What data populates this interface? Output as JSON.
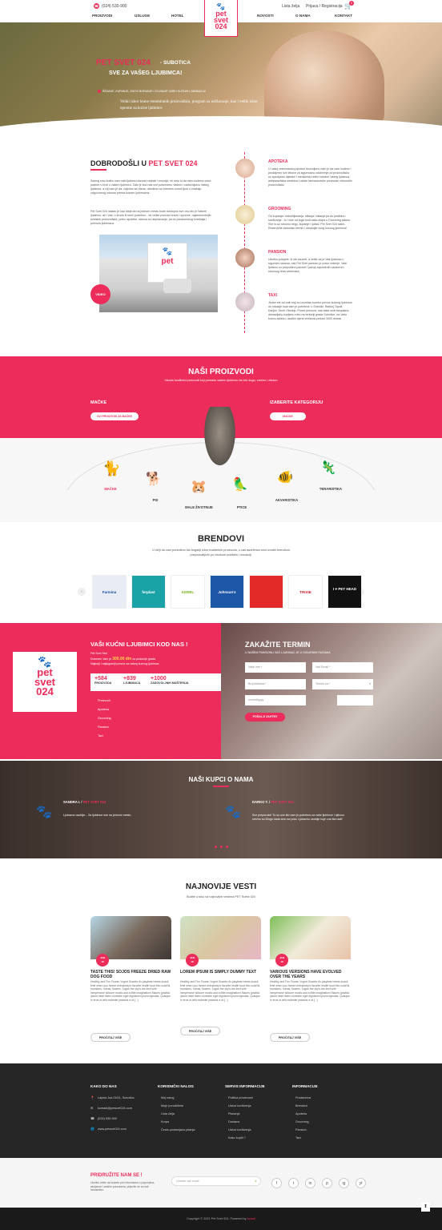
{
  "topbar": {
    "phone": "(024) 530-900",
    "wishlist": "Lista želja",
    "login": "Prijava / Registracija",
    "cart_count": "0"
  },
  "nav": {
    "left": [
      "PROIZVODI",
      "USLUGE",
      "HOTEL"
    ],
    "right": [
      "NOVOSTI",
      "O NAMA",
      "KONTAKT"
    ]
  },
  "logo": {
    "line1": "pet",
    "line2": "svet",
    "line3": "024"
  },
  "hero": {
    "brand": "PET SVET 024",
    "city": "- SUBOTICA",
    "subtitle": "SVE ZA VAŠEG LJUBIMCA!",
    "tagline": "ŠIŠANJE, KUPANJE, ZNOVI BORANJE I ČUVANJE VAŠIH KUĆNIH LJUBIMACA!",
    "text": "Veliki izbor hrane renomiranih proizvođača, program za održavanje, kao i veliki izbor opreme za kućne ljubimce"
  },
  "welcome": {
    "title": "DOBRODOŠLI U",
    "brand": "PET SVET 024",
    "p1": "Saznaj smo koliko nam naši ljubimci donose radosti i emocija, mi smo tu da vam budemo pravi partner u brizi o vašem ljubimcu. Zato je kod nas sve posvećeno Vašem i zadovoljstvu Vašeg ljubimca, a cilj nam je da, zajedno sa Vama, ubedimo na vremenu svesti ljudi o značaju odgovornog odnosa prema kućnim ljubimcima.",
    "p2": "Pet Svet 024 nastao je kao ideja da na jednom mestu bude dostupno sve ono što je Vašem ljubimcu, ali i Vas, u životu ili sreći potrebno - od velike ponude hrane i opreme, najeminentnijih svetskih proizvođača, preko apoteke, salona za ulepšavanje, pa do pansionskog smeštaja i prevoza ljubimaca.",
    "video_label": "VIDEO"
  },
  "services": [
    {
      "title": "APOTEKA",
      "text": "U našoj veterinarskoj apoteci dozvoljeno nam je da vam nudimo i prodajemo sve lekove za sigurnosno odobrenje od proizvođača uz specijalan dijetalni i medicinski režim ishrane Vašeg ljubimca, antiparazitska sredstva i ostale farmaceutske proizvode vrhunskih proizvođača."
    },
    {
      "title": "GROOMING",
      "text": "Od kupanja i raščešljavanja, šišanja i šišanja pa do pedikira i sređivanja - to i više od toga nudi naša ekipa u Grooming salonu. Sve to uz stručnu negu, kupanje i ljubav. Pet Svet 024 salon. Rezervišite slobodan termin i ulepšajte svog kućnog ljubimca!"
    },
    {
      "title": "PANSION",
      "text": "Ukoliko putujete, ili ste zauzeti, a želite da je Vaš ljubimac u sigurnim rukama, naš Pet Svet pansion je pravo rešenje. Vaši ljubimci su prepušteni pomoći i pažnji zaposlenih nadzorom stručnog tima veterinara."
    },
    {
      "title": "TAXI",
      "text": "Jedan ste od onih koji su izuzetan komfor prevoz kućnog ljubimca do lokacije koja vam je potrebna: u Subotici, Bačkoj Topoli, Kanjiži, Senti i Bečeju. Pored prevoza, naš taksi nudi besplatnu dostavljaču kupljenu robu na teritoriji grada Subotice, na Vašu kućnu adresu, ukoliko njena vrednost prelazi 3000 dinara."
    }
  ],
  "products": {
    "title": "NAŠI PROIZVODI",
    "subtitle": "Visoka kvalitetni proizvodi koji pomažu vašem ljubimcu da živi dugo, srećno i zdravo",
    "left_label": "MAČKE",
    "left_btn": "SVI PROIZVODI ZA MAČKE",
    "right_label": "IZABERITE KATEGORIJU",
    "right_btn": "MAČKE",
    "animals": [
      "MAČKE",
      "PSI",
      "MALE ŽIVOTINJE",
      "PTICE",
      "AKVARISTIKA",
      "TERARISTIKA"
    ]
  },
  "brands": {
    "title": "BRENDOVI",
    "subtitle": "U želji da vam ponudimo što bogatiji izbor kvalitetnih proizvoda, u naš asortiman smo uvrstili brendova prepoznatljivih po visokom kvalitetu i inovaciji.",
    "items": [
      "Farmina",
      "ferplast",
      "KERBL",
      "Johnson's",
      "",
      "TRIXIE",
      "I ♥ PET HEAD"
    ]
  },
  "pets": {
    "title": "VAŠI KUĆNI LJUBIMCI KOD NAS !",
    "line1": "Pet Svet Taxi",
    "line2": "Dovezen Vam je",
    "amount": "300.00 din",
    "line2b": "za područje grada",
    "line3": "Najbolji i najsigurniji prevoz za vašeg kućnog ljubimca",
    "stats": [
      {
        "value": "+584",
        "label": "PROIZVODA"
      },
      {
        "value": "+839",
        "label": "LJUBIMACA"
      },
      {
        "value": "+1000",
        "label": "ZADOVOLJNIH MUŠTERIJA"
      }
    ],
    "list": [
      "Proizvodi",
      "Apoteka",
      "Grooming",
      "Pansion",
      "Taxi"
    ]
  },
  "appointment": {
    "title": "ZAKAŽITE TERMIN",
    "subtitle": "U NAŠEM PANSIONU VAŠ LJUBIMAC JE U SIGURNIM RUKAMA",
    "name_ph": "Vaše ime *",
    "email_ph": "Vaš Email *",
    "phone_ph": "Broj telefona *",
    "service": "Termin za *",
    "date_ph": "mm/dd/yyyy",
    "submit": "POŠALJI ZAHTEV"
  },
  "testimonials": {
    "title": "NAŠI KUPCI O NAMA",
    "items": [
      {
        "name": "SANDRA I.",
        "brand": "PET SVET 024",
        "text": "Ljubazno osoblje... Za ljubimce sve na jednom mestu"
      },
      {
        "name": "DARKO T.",
        "brand": "PET SVET 024",
        "text": "Sve preporuke! Tu su sve što vam je potrebno za vaše ljubimce i njihovo srećno sa Dingo kada smo sa puta. Ljubazno osoblje koje zna šta radi!"
      }
    ]
  },
  "news": {
    "title": "NAJNOVIJE VESTI",
    "subtitle": "Budite u toku sa najnovijim vestima PET Sveta 024",
    "items": [
      {
        "month": "JAN",
        "day": "18",
        "title": "TASTE THIS! SOJOS FREEZE DRIED RAW DOG FOOD",
        "text": "Healthy and Fun Frozen Yogurt Snacks it's playtime meets snack time when you freeze everybody's favorite health food into colorful monsters, robots, flowers. Logos the sky's the limit with inexpensive silicone molds and a little imagination! Mauris gravida ipsum vitae libero molestie eget dignissim ipsum egestas. Quisque in eros id velit molestie placerat a ut [...]",
        "btn": "PROČITAJ VIŠE"
      },
      {
        "month": "JAN",
        "day": "18",
        "title": "LOREM IPSUM IS SIMPLY DUMMY TEXT",
        "text": "Healthy and Fun Frozen Yogurt Snacks it's playtime meets snack time when you freeze everybody's favorite health food into colorful monsters, robots, flowers. Logos the sky's the limit with inexpensive silicone molds and a little imagination! Mauris gravida ipsum vitae libero molestie eget dignissim ipsum egestas. Quisque in eros id velit molestie placerat a ut [...]",
        "btn": "PROČITAJ VIŠE"
      },
      {
        "month": "JAN",
        "day": "18",
        "title": "VARIOUS VERSIONS HAVE EVOLVED OVER THE YEARS",
        "text": "Healthy and Fun Frozen Yogurt Snacks it's playtime meets snack time when you freeze everybody's favorite health food into colorful monsters, robots, flowers. Logos the sky's the limit with inexpensive silicone molds and a little imagination! Mauris gravida ipsum vitae libero molestie eget dignissim ipsum egestas. Quisque in eros id velit molestie placerat a ut [...]",
        "btn": "PROČITAJ VIŠE"
      }
    ]
  },
  "footer": {
    "cols": [
      {
        "title": "KAKO DO NAS",
        "items": [
          "Lajoša Joa 24/11, Subotica",
          "kontakt@petsvet024.com",
          "(024) 530-900",
          "www.petsvet024.com"
        ]
      },
      {
        "title": "KORISNIČKI NALOG",
        "items": [
          "Moj nalog",
          "Moje porudžbine",
          "Lista želja",
          "Korpa",
          "Često postavljana pitanja"
        ]
      },
      {
        "title": "SERVIS INFORMACIJE",
        "items": [
          "Politika privatnosti",
          "Uslovi korišćenja",
          "Plaćanje",
          "Dostava",
          "Uslovi korišćenja",
          "Kako kupiti ?"
        ]
      },
      {
        "title": "INFORMACIJE",
        "items": [
          "Prodavnica",
          "Brendovi",
          "Apoteka",
          "Grooming",
          "Pansion",
          "Taxi"
        ]
      }
    ]
  },
  "newsletter": {
    "title": "PRIDRUŽITE NAM SE !",
    "text": "Ukoliko želite da budete prvi informisani o popustima, akcijama i ostalim ponudama, prijavite se za naš Newsletter.",
    "placeholder": "Unesite vaš email",
    "socials": [
      "f",
      "t",
      "in",
      "p",
      "ig",
      "yt"
    ]
  },
  "copyright": {
    "text": "Copyright © 2021 Pet Svet 024. Powered by",
    "powered": "Actual"
  },
  "colors": {
    "accent": "#ec2d5b",
    "dark": "#262626"
  }
}
